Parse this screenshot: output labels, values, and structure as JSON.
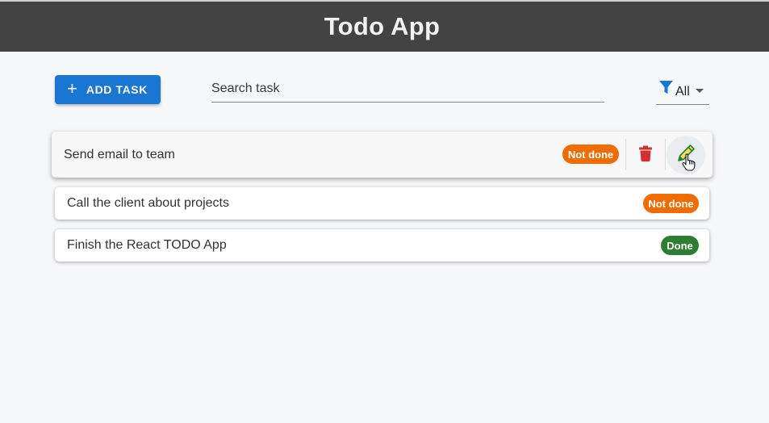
{
  "header": {
    "title": "Todo App"
  },
  "toolbar": {
    "add_label": "ADD TASK",
    "add_icon": "plus-icon",
    "search_placeholder": "Search task",
    "search_value": "",
    "filter_value": "All",
    "filter_icon": "filter-icon"
  },
  "colors": {
    "header_bg": "#434343",
    "primary": "#1976d2",
    "not_done": "#ef6c00",
    "done": "#2e7d32",
    "delete": "#d32f2f"
  },
  "tasks": [
    {
      "text": "Send email to team",
      "status": "Not done",
      "status_color": "#ef6c00"
    },
    {
      "text": "Call the client about projects",
      "status": "Not done",
      "status_color": "#ef6c00"
    },
    {
      "text": "Finish the React TODO App",
      "status": "Done",
      "status_color": "#2e7d32"
    }
  ],
  "task_actions": {
    "delete_icon": "trash-icon",
    "edit_icon": "pencil-icon"
  }
}
